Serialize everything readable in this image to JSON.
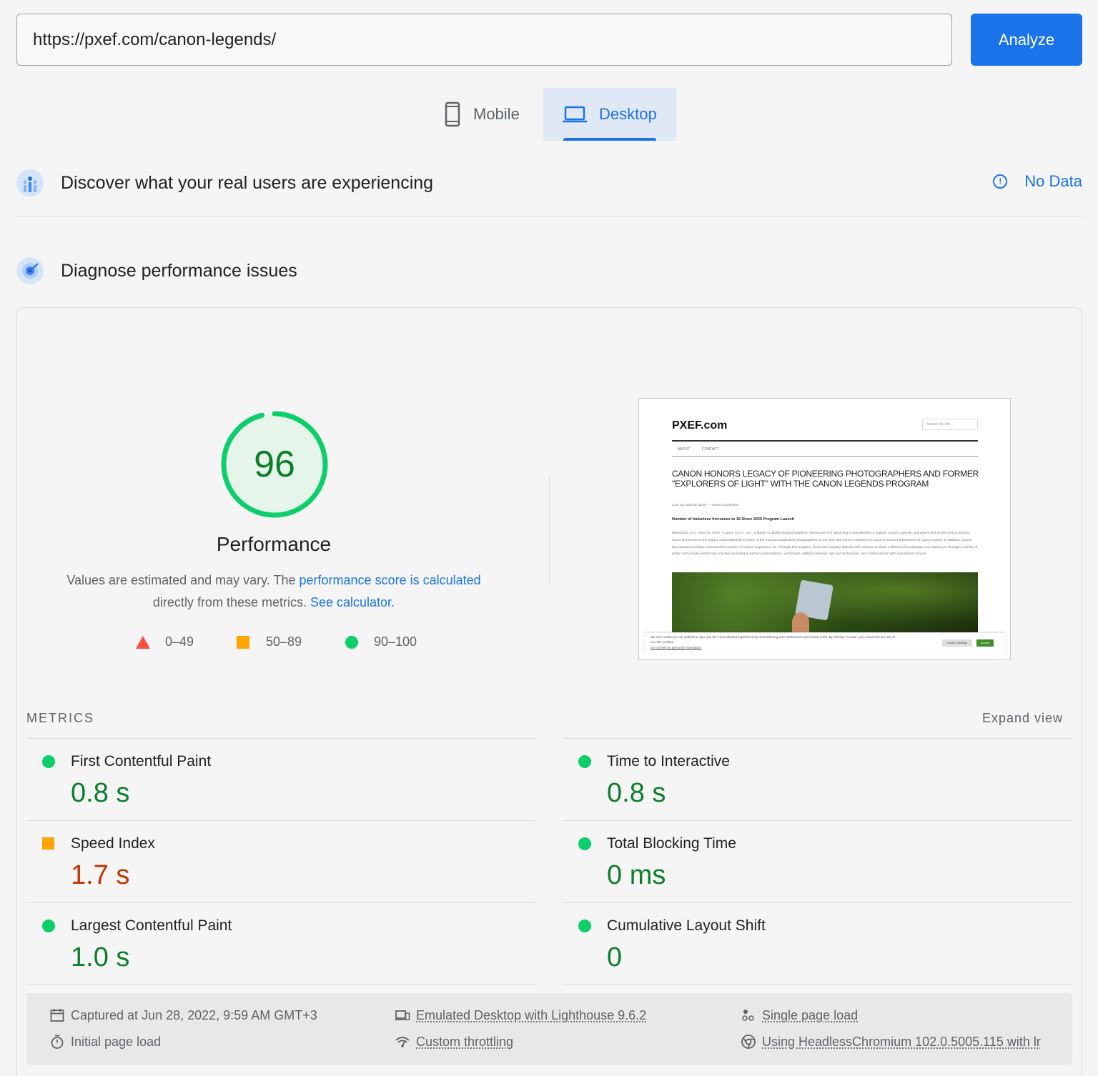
{
  "url_bar": {
    "value": "https://pxef.com/canon-legends/"
  },
  "analyze_label": "Analyze",
  "tabs": [
    {
      "label": "Mobile"
    },
    {
      "label": "Desktop"
    }
  ],
  "field_section": {
    "title": "Discover what your real users are experiencing",
    "status": "No Data"
  },
  "lab_section": {
    "title": "Diagnose performance issues"
  },
  "performance": {
    "score": "96",
    "score_fraction": 0.96,
    "title": "Performance",
    "desc_prefix": "Values are estimated and may vary. The ",
    "desc_link1": "performance score is calculated",
    "desc_mid": "directly from these metrics. ",
    "desc_link2": "See calculator.",
    "legend": [
      "0–49",
      "50–89",
      "90–100"
    ]
  },
  "preview": {
    "site_name": "PXEF.com",
    "search_placeholder": "Search the site ...",
    "nav": [
      "ABOUT",
      "CONTACT"
    ],
    "headline": "CANON HONORS LEGACY OF PIONEERING PHOTOGRAPHERS AND FORMER \"EXPLORERS OF LIGHT\" WITH THE CANON LEGENDS PROGRAM",
    "byline": "June 15, 2022 By admin — Leave a Comment",
    "subhead": "Number of Inductees Increases to 18 Since 2020 Program Launch",
    "body": "MELVILLE, N.Y., June 15, 2022 – Canon U.S.A., Inc., a leader in digital imaging solutions, announced it is launching a new website to support Canon Legends, a program first announced in 2020 to honor and preserve the legacy and leadership of some of the most accomplished photographers of our time and former members of Canon's renowned Explorers of Light program. In addition, Canon has announced it has increased the number of Canon Legends to 18. Through this program, these true industry legends will continue to share a lifetime of knowledge and experience through a variety of public and private events and activities including in-person presentations, workshops, editorial features, tips and techniques, and collaborations with educational venues.",
    "cookie_text": "We use cookies on our website to give you the most relevant experience by remembering your preferences and repeat visits. By clicking \"Accept\", you consent to the use of ALL the cookies.",
    "cookie_link": "Do not sell my personal information.",
    "cookie_settings": "Cookie Settings",
    "cookie_accept": "Accept"
  },
  "metrics": {
    "label": "METRICS",
    "expand": "Expand view",
    "items": [
      {
        "name": "First Contentful Paint",
        "value": "0.8 s",
        "rating": "good"
      },
      {
        "name": "Time to Interactive",
        "value": "0.8 s",
        "rating": "good"
      },
      {
        "name": "Speed Index",
        "value": "1.7 s",
        "rating": "average"
      },
      {
        "name": "Total Blocking Time",
        "value": "0 ms",
        "rating": "good"
      },
      {
        "name": "Largest Contentful Paint",
        "value": "1.0 s",
        "rating": "good"
      },
      {
        "name": "Cumulative Layout Shift",
        "value": "0",
        "rating": "good"
      }
    ]
  },
  "footer": {
    "captured": "Captured at Jun 28, 2022, 9:59 AM GMT+3",
    "initial_load": "Initial page load",
    "emulated": "Emulated Desktop with Lighthouse 9.6.2",
    "throttling": "Custom throttling",
    "single_load": "Single page load",
    "browser": "Using HeadlessChromium 102.0.5005.115 with lr"
  },
  "colors": {
    "accent": "#1a73e8",
    "good": "#0cce6b",
    "average": "#ffa400",
    "poor": "#ff4e42"
  }
}
